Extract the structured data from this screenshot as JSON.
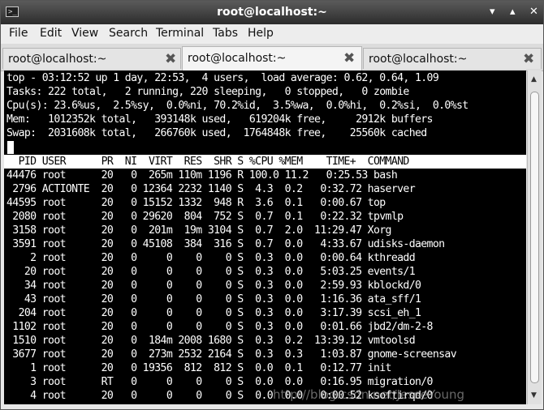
{
  "window": {
    "title": "root@localhost:~",
    "minimize_glyph": "▾",
    "maximize_glyph": "▴",
    "close_glyph": "✕",
    "icon_glyph": ">_"
  },
  "menu": [
    "File",
    "Edit",
    "View",
    "Search",
    "Terminal",
    "Tabs",
    "Help"
  ],
  "tabs": [
    {
      "label": "root@localhost:~",
      "active": false
    },
    {
      "label": "root@localhost:~",
      "active": true
    },
    {
      "label": "root@localhost:~",
      "active": false
    }
  ],
  "tab_close_glyph": "✖",
  "top_summary": [
    "top - 03:12:52 up 1 day, 22:53,  4 users,  load average: 0.62, 0.64, 1.09",
    "Tasks: 222 total,   2 running, 220 sleeping,   0 stopped,   0 zombie",
    "Cpu(s): 23.6%us,  2.5%sy,  0.0%ni, 70.2%id,  3.5%wa,  0.0%hi,  0.2%si,  0.0%st",
    "Mem:   1012352k total,   393148k used,   619204k free,     2912k buffers",
    "Swap:  2031608k total,   266760k used,  1764848k free,    25560k cached"
  ],
  "process_header": "  PID USER      PR  NI  VIRT  RES  SHR S %CPU %MEM    TIME+  COMMAND",
  "processes": [
    "44476 root      20   0  265m 110m 1196 R 100.0 11.2   0:25.53 bash",
    " 2796 ACTIONTE  20   0 12364 2232 1140 S  4.3  0.2   0:32.72 haserver",
    "44595 root      20   0 15152 1332  948 R  3.6  0.1   0:00.67 top",
    " 2080 root      20   0 29620  804  752 S  0.7  0.1   0:22.32 tpvmlp",
    " 3158 root      20   0  201m  19m 3104 S  0.7  2.0  11:29.47 Xorg",
    " 3591 root      20   0 45108  384  316 S  0.7  0.0   4:33.67 udisks-daemon",
    "    2 root      20   0     0    0    0 S  0.3  0.0   0:00.64 kthreadd",
    "   20 root      20   0     0    0    0 S  0.3  0.0   5:03.25 events/1",
    "   34 root      20   0     0    0    0 S  0.3  0.0   2:59.93 kblockd/0",
    "   43 root      20   0     0    0    0 S  0.3  0.0   1:16.36 ata_sff/1",
    "  204 root      20   0     0    0    0 S  0.3  0.0   3:17.39 scsi_eh_1",
    " 1102 root      20   0     0    0    0 S  0.3  0.0   0:01.66 jbd2/dm-2-8",
    " 1510 root      20   0  184m 2008 1680 S  0.3  0.2  13:39.12 vmtoolsd",
    " 3677 root      20   0  273m 2532 2164 S  0.3  0.3   1:03.87 gnome-screensav",
    "    1 root      20   0 19356  812  812 S  0.0  0.1   0:12.77 init",
    "    3 root      RT   0     0    0    0 S  0.0  0.0   0:16.95 migration/0",
    "    4 root      20   0     0    0    0 S  0.0  0.0   0:00.52 ksoftirqd/0"
  ],
  "watermark": "http://blog.csdn.net/JesseYoung",
  "scroll_up_glyph": "▲",
  "scroll_down_glyph": "▼",
  "colors": {
    "titlebar": "#3a3a3a",
    "terminal_bg": "#000000",
    "terminal_fg": "#ffffff",
    "header_row_bg": "#ffffff"
  }
}
